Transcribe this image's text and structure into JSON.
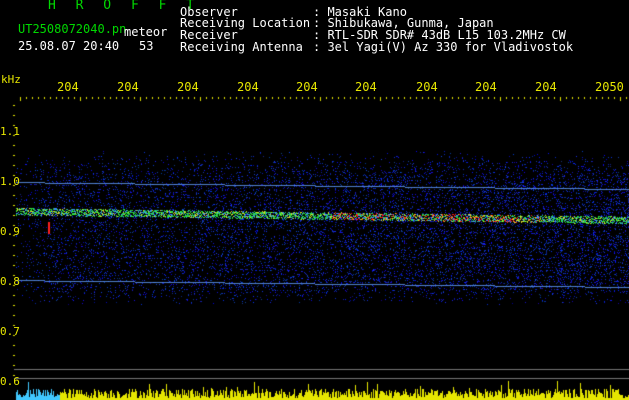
{
  "header": {
    "title": "H R O F F T",
    "filename": "UT2508072040.pn",
    "meteor_label": "meteor",
    "datetime": "25.08.07 20:40",
    "count": "53"
  },
  "station": {
    "observer_label": "Observer",
    "observer_value": ": Masaki Kano",
    "location_label": "Receiving Location",
    "location_value": ": Shibukawa, Gunma, Japan",
    "receiver_label": "Receiver",
    "receiver_value": ": RTL-SDR SDR# 43dB L15 103.2MHz CW",
    "antenna_label": "Receiving Antenna",
    "antenna_value": ": 3el Yagi(V) Az 330 for Vladivostok"
  },
  "axes": {
    "y_unit": "kHz",
    "y_ticks": [
      "1.1",
      "1.0",
      "0.9",
      "0.8",
      "0.7",
      "0.6"
    ],
    "x_ticks": [
      "204",
      "204",
      "204",
      "204",
      "204",
      "204",
      "204",
      "204",
      "204",
      "2050"
    ]
  },
  "colors": {
    "text_green": "#00d800",
    "text_white": "#ffffff",
    "text_yellow": "#e6e600",
    "noise_blue": "#0a28c8",
    "band_line": "#64a0ff",
    "echo_red": "#ff2020",
    "histogram_yellow": "#e6e600",
    "histogram_cyan": "#40c8ff"
  }
}
